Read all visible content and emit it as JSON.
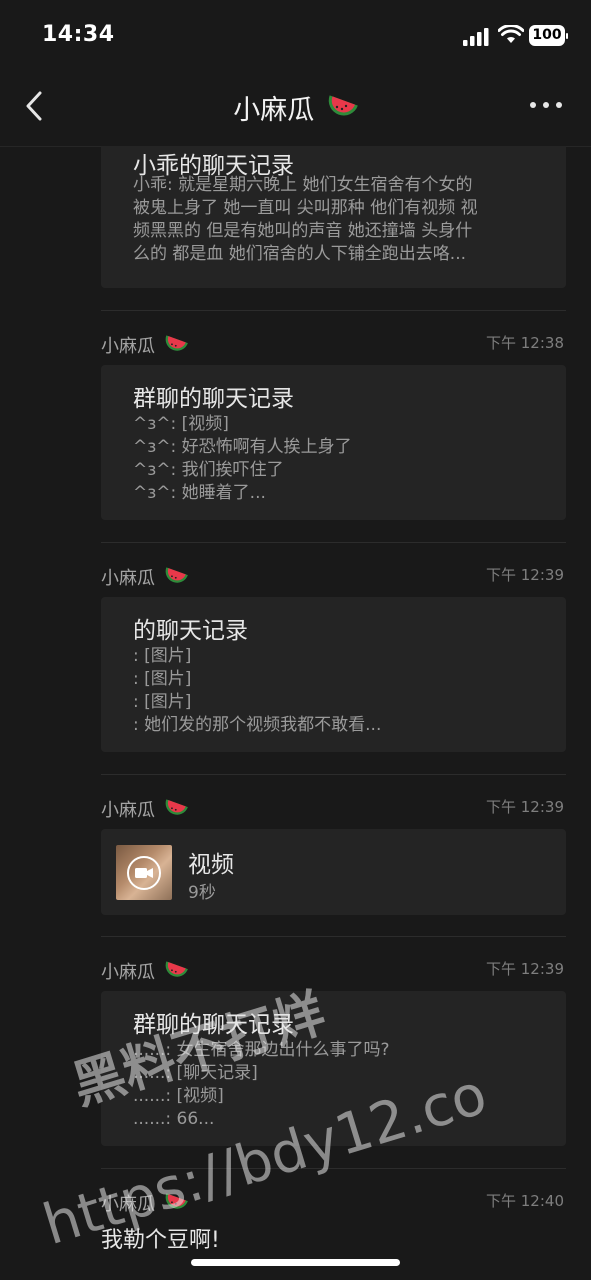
{
  "status": {
    "time": "14:34",
    "battery": "100"
  },
  "nav": {
    "title": "小麻瓜",
    "title_emoji": "watermelon-icon"
  },
  "messages": [
    {
      "sender": "",
      "time": "",
      "card_title": "小乖的聊天记录",
      "lines": [
        "小乖: 就是星期六晚上 她们女生宿舍有个女的",
        "被鬼上身了 她一直叫 尖叫那种 他们有视频 视",
        "频黑黑的 但是有她叫的声音 她还撞墙 头身什",
        "么的 都是血 她们宿舍的人下铺全跑出去咯..."
      ]
    },
    {
      "sender": "小麻瓜",
      "time": "下午 12:38",
      "card_title": "群聊的聊天记录",
      "lines": [
        "^ɜ^: [视频]",
        "^ɜ^: 好恐怖啊有人挨上身了",
        "^ɜ^: 我们挨吓住了",
        "^ɜ^: 她睡着了..."
      ]
    },
    {
      "sender": "小麻瓜",
      "time": "下午 12:39",
      "card_title": "的聊天记录",
      "lines": [
        ": [图片]",
        ": [图片]",
        ": [图片]",
        ": 她们发的那个视频我都不敢看..."
      ]
    },
    {
      "sender": "小麻瓜",
      "time": "下午 12:39",
      "video_title": "视频",
      "video_duration": "9秒"
    },
    {
      "sender": "小麻瓜",
      "time": "下午 12:39",
      "card_title": "群聊的聊天记录",
      "lines": [
        "......: 女生宿舍那边出什么事了吗?",
        "......: [聊天记录]",
        "......: [视频]",
        "......: 66..."
      ]
    },
    {
      "sender": "小麻瓜",
      "time": "下午 12:40",
      "text": "我勒个豆啊!"
    }
  ],
  "watermark": {
    "line1": "黑料不打烊",
    "line2": "https://bdy12.co"
  }
}
